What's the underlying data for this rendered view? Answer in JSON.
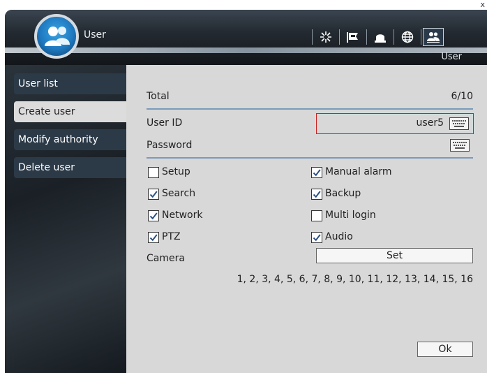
{
  "window": {
    "title": "User",
    "section": "User",
    "close": "x"
  },
  "toolbar": {
    "icons": [
      "settings-icon",
      "alarm-flag-icon",
      "bell-icon",
      "globe-icon",
      "user-icon"
    ]
  },
  "sidebar": {
    "items": [
      {
        "label": "User list",
        "active": false
      },
      {
        "label": "Create user",
        "active": true
      },
      {
        "label": "Modify authority",
        "active": false
      },
      {
        "label": "Delete user",
        "active": false
      }
    ]
  },
  "form": {
    "total_label": "Total",
    "total_value": "6/10",
    "user_id_label": "User ID",
    "user_id_value": "user5",
    "password_label": "Password",
    "password_value": "",
    "permissions": [
      {
        "label": "Setup",
        "checked": false
      },
      {
        "label": "Manual alarm",
        "checked": true
      },
      {
        "label": "Search",
        "checked": true
      },
      {
        "label": "Backup",
        "checked": true
      },
      {
        "label": "Network",
        "checked": true
      },
      {
        "label": "Multi login",
        "checked": false
      },
      {
        "label": "PTZ",
        "checked": true
      },
      {
        "label": "Audio",
        "checked": true
      }
    ],
    "camera_label": "Camera",
    "set_label": "Set",
    "camera_list": "1, 2, 3, 4, 5, 6, 7, 8, 9, 10, 11, 12, 13, 14, 15, 16",
    "ok_label": "Ok"
  },
  "colors": {
    "accent": "#7a9abb",
    "focus_border": "#cc2222",
    "panel": "#d8d8d8",
    "sidebar_item": "#2c3a48"
  }
}
